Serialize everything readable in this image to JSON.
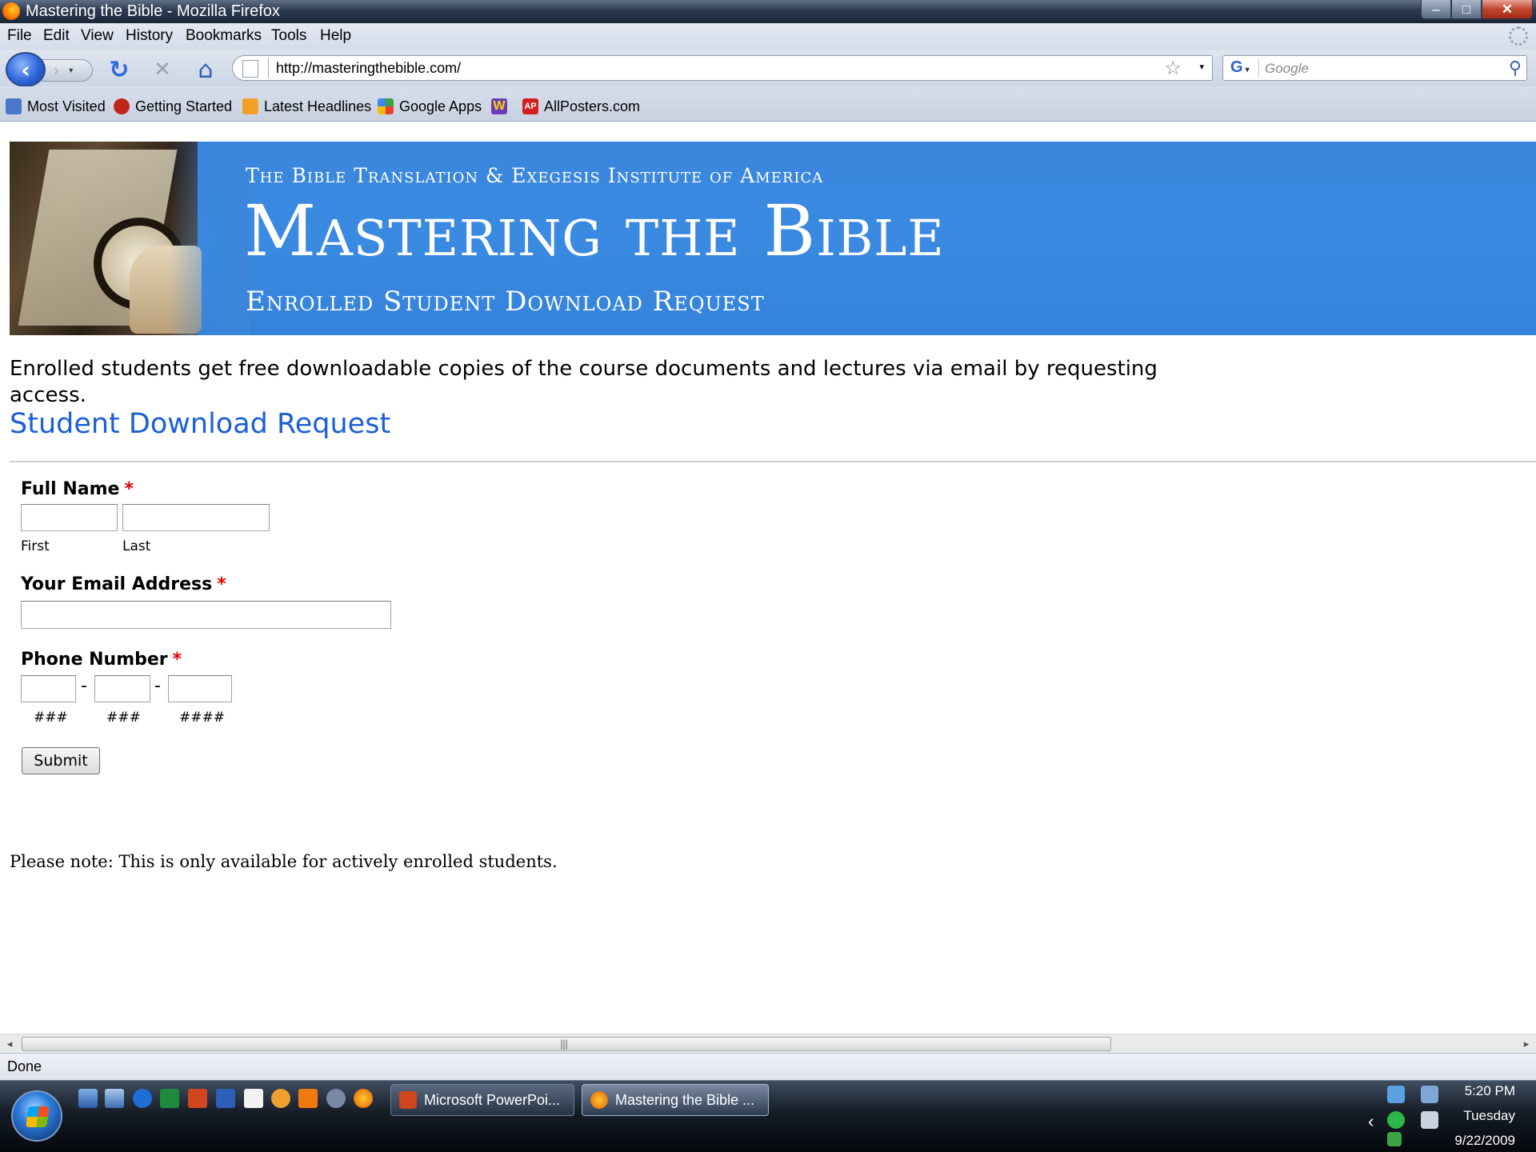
{
  "window": {
    "title": "Mastering the Bible - Mozilla Firefox",
    "controls": {
      "minimize": "–",
      "maximize": "□",
      "close": "✕"
    }
  },
  "menubar": {
    "items": [
      "File",
      "Edit",
      "View",
      "History",
      "Bookmarks",
      "Tools",
      "Help"
    ]
  },
  "toolbar": {
    "back_glyph": "‹",
    "forward_glyph": "›",
    "reload_glyph": "↻",
    "stop_glyph": "✕",
    "home_glyph": "⌂",
    "url": "http://masteringthebible.com/",
    "bookmark_star": "☆",
    "dropdown_glyph": "▾",
    "search_engine": "G",
    "search_placeholder": "Google",
    "search_glyph": "⚲"
  },
  "bookmarks": {
    "items": [
      {
        "label": "Most Visited",
        "icon": "most-visited-icon",
        "color": "#4a78c8"
      },
      {
        "label": "Getting Started",
        "icon": "firefox-icon",
        "color": "#c0261b"
      },
      {
        "label": "Latest Headlines",
        "icon": "rss-icon",
        "color": "#f2a125"
      },
      {
        "label": "Google Apps",
        "icon": "google-apps-icon",
        "color": "#3aa344"
      },
      {
        "label": "",
        "icon": "w-icon",
        "color": "#6a3fb5"
      },
      {
        "label": "AllPosters.com",
        "icon": "allposters-icon",
        "color": "#d42020"
      }
    ]
  },
  "banner": {
    "supertitle": "The Bible Translation & Exegesis Institute of America",
    "title": "Mastering the Bible",
    "subtitle": "Enrolled Student Download Request",
    "color": "#3a8ae2"
  },
  "content": {
    "intro": "Enrolled students get free downloadable copies of the course documents and lectures via email by requesting access.",
    "form_title": "Student Download Request",
    "link_color": "#1a5fd6",
    "note": "Please note: This is only available for actively enrolled students."
  },
  "form": {
    "required_mark": "*",
    "full_name": {
      "label": "Full Name",
      "first_sub": "First",
      "last_sub": "Last",
      "first_value": "",
      "last_value": ""
    },
    "email": {
      "label": "Your Email Address",
      "value": ""
    },
    "phone": {
      "label": "Phone Number",
      "sep": "-",
      "area_hint": "###",
      "prefix_hint": "###",
      "line_hint": "####"
    },
    "submit": "Submit"
  },
  "scrollbar": {
    "left_arrow": "◂",
    "right_arrow": "▸",
    "grip": "|||"
  },
  "status": {
    "text": "Done"
  },
  "taskbar": {
    "tasks": [
      {
        "label": "Microsoft PowerPoi...",
        "icon": "powerpoint-icon"
      },
      {
        "label": "Mastering the Bible ...",
        "icon": "firefox-icon"
      }
    ],
    "tray_arrow": "‹",
    "clock": {
      "time": "5:20 PM",
      "day": "Tuesday",
      "date": "9/22/2009"
    }
  }
}
